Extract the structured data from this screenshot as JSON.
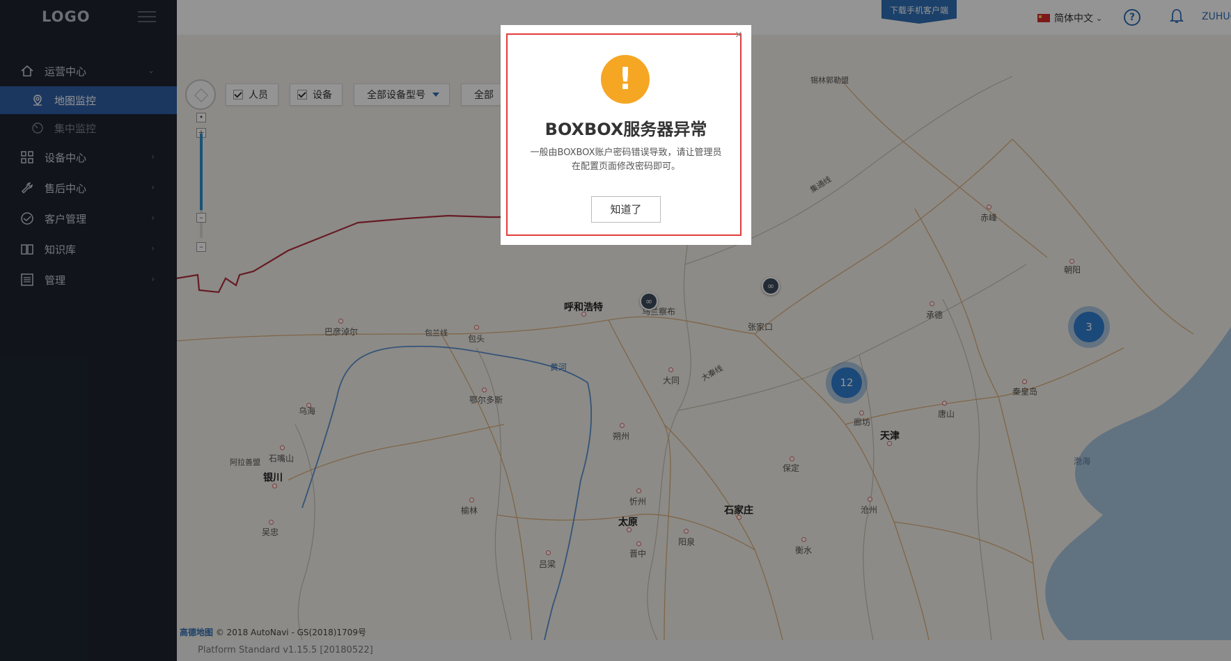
{
  "sidebar": {
    "logo": "LOGO",
    "items": [
      {
        "label": "运营中心",
        "icon": "home-icon",
        "expanded": true,
        "children": [
          {
            "label": "地图监控",
            "icon": "map-pin-icon",
            "active": true
          },
          {
            "label": "集中监控",
            "icon": "gauge-icon",
            "active": false
          }
        ]
      },
      {
        "label": "设备中心",
        "icon": "grid-icon"
      },
      {
        "label": "售后中心",
        "icon": "wrench-icon"
      },
      {
        "label": "客户管理",
        "icon": "handshake-icon"
      },
      {
        "label": "知识库",
        "icon": "book-icon"
      },
      {
        "label": "管理",
        "icon": "settings-list-icon"
      }
    ]
  },
  "header": {
    "download_label": "下载手机客户端",
    "language": "简体中文",
    "user": "ZUHUC"
  },
  "filters": {
    "person_label": "人员",
    "device_label": "设备",
    "device_type": "全部设备型号",
    "all_label": "全部"
  },
  "map": {
    "clusters": [
      {
        "label": "12"
      },
      {
        "label": "3"
      }
    ],
    "cities": [
      {
        "name": "锡林郭勒盟",
        "big": false
      },
      {
        "name": "集通线",
        "big": false
      },
      {
        "name": "赤峰",
        "big": false
      },
      {
        "name": "朝阳",
        "big": false
      },
      {
        "name": "承德",
        "big": false
      },
      {
        "name": "呼和浩特",
        "big": true
      },
      {
        "name": "乌兰察布",
        "big": false
      },
      {
        "name": "张家口",
        "big": false
      },
      {
        "name": "巴彦淖尔",
        "big": false
      },
      {
        "name": "包兰线",
        "big": false
      },
      {
        "name": "包头",
        "big": false
      },
      {
        "name": "黄河",
        "big": false
      },
      {
        "name": "大同",
        "big": false
      },
      {
        "name": "大秦线",
        "big": false
      },
      {
        "name": "鄂尔多斯",
        "big": false
      },
      {
        "name": "乌海",
        "big": false
      },
      {
        "name": "廊坊",
        "big": false
      },
      {
        "name": "唐山",
        "big": false
      },
      {
        "name": "秦皇岛",
        "big": false
      },
      {
        "name": "天津",
        "big": true
      },
      {
        "name": "朔州",
        "big": false
      },
      {
        "name": "石嘴山",
        "big": false
      },
      {
        "name": "阿拉善盟",
        "big": false
      },
      {
        "name": "渤海",
        "big": false
      },
      {
        "name": "保定",
        "big": false
      },
      {
        "name": "银川",
        "big": true
      },
      {
        "name": "忻州",
        "big": false
      },
      {
        "name": "榆林",
        "big": false
      },
      {
        "name": "太原",
        "big": true
      },
      {
        "name": "石家庄",
        "big": true
      },
      {
        "name": "沧州",
        "big": false
      },
      {
        "name": "吴忠",
        "big": false
      },
      {
        "name": "阳泉",
        "big": false
      },
      {
        "name": "晋中",
        "big": false
      },
      {
        "name": "衡水",
        "big": false
      },
      {
        "name": "吕梁",
        "big": false
      }
    ],
    "copyright_brand": "高德地图",
    "copyright_text": "© 2018 AutoNavi - GS(2018)1709号",
    "version": "Platform Standard v1.15.5 [20180522]"
  },
  "modal": {
    "title": "BOXBOX服务器异常",
    "body_line1": "一般由BOXBOX账户密码错误导致，请让管理员",
    "body_line2": "在配置页面修改密码即可。",
    "button": "知道了",
    "close": "×",
    "icon": "warning-icon",
    "accent_color": "#f5a623",
    "frame_color": "#e23c3c"
  }
}
